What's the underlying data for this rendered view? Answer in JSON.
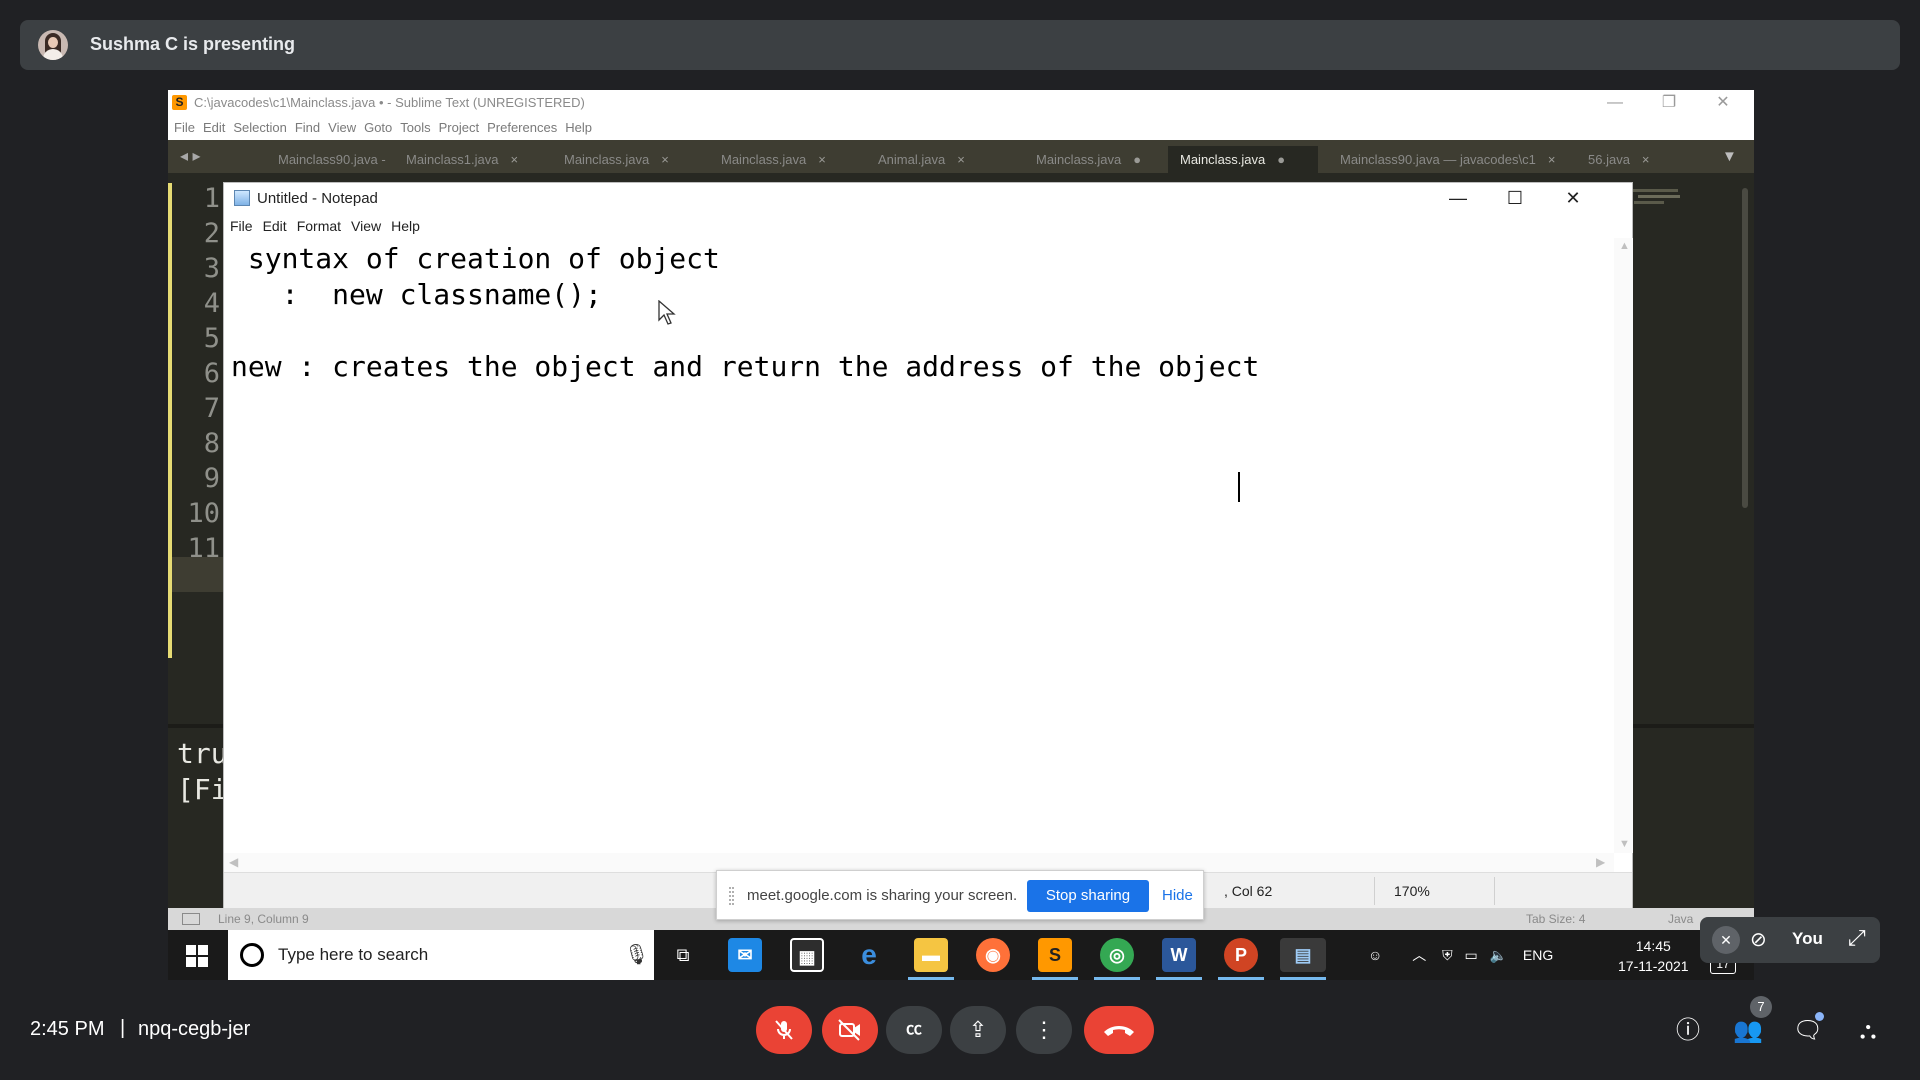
{
  "presenting": {
    "text": "Sushma C is presenting"
  },
  "sublime": {
    "window_title": "C:\\javacodes\\c1\\Mainclass.java • - Sublime Text (UNREGISTERED)",
    "menu": [
      "File",
      "Edit",
      "Selection",
      "Find",
      "View",
      "Goto",
      "Tools",
      "Project",
      "Preferences",
      "Help"
    ],
    "tabs": [
      {
        "label": "Mainclass90.java -",
        "close": ""
      },
      {
        "label": "Mainclass1.java",
        "close": "×"
      },
      {
        "label": "Mainclass.java",
        "close": "×"
      },
      {
        "label": "Mainclass.java",
        "close": "×"
      },
      {
        "label": "Animal.java",
        "close": "×"
      },
      {
        "label": "Mainclass.java",
        "close": "●"
      },
      {
        "label": "Mainclass.java",
        "close": "●"
      },
      {
        "label": "Mainclass90.java — javacodes\\c1",
        "close": "×"
      },
      {
        "label": "56.java",
        "close": "×"
      }
    ],
    "line_numbers": [
      "1",
      "2",
      "3",
      "4",
      "5",
      "6",
      "7",
      "8",
      "9",
      "10",
      "11"
    ],
    "console_lines": "tru\n[Fi",
    "status": {
      "position": "Line 9, Column 9",
      "tab_size": "Tab Size: 4",
      "syntax": "Java"
    }
  },
  "notepad": {
    "title": "Untitled - Notepad",
    "menu": [
      "File",
      "Edit",
      "Format",
      "View",
      "Help"
    ],
    "content": " syntax of creation of object\n   :  new classname();\n\nnew : creates the object and return the address of the object",
    "status": {
      "col": ", Col 62",
      "zoom": "170%"
    }
  },
  "share_notice": {
    "text": "meet.google.com is sharing your screen.",
    "stop_label": "Stop sharing",
    "hide_label": "Hide"
  },
  "taskbar": {
    "search_placeholder": "Type here to search",
    "lang": "ENG",
    "time": "14:45",
    "date": "17-11-2021",
    "notification_count": "17"
  },
  "self_view": {
    "name": "You"
  },
  "meet": {
    "time": "2:45 PM",
    "separator": "|",
    "code": "npq-cegb-jer",
    "people_count": "7"
  },
  "colors": {
    "accent": "#1a73e8",
    "danger": "#ea4335",
    "meet_bg": "#202124",
    "sublime_bg": "#272822"
  }
}
